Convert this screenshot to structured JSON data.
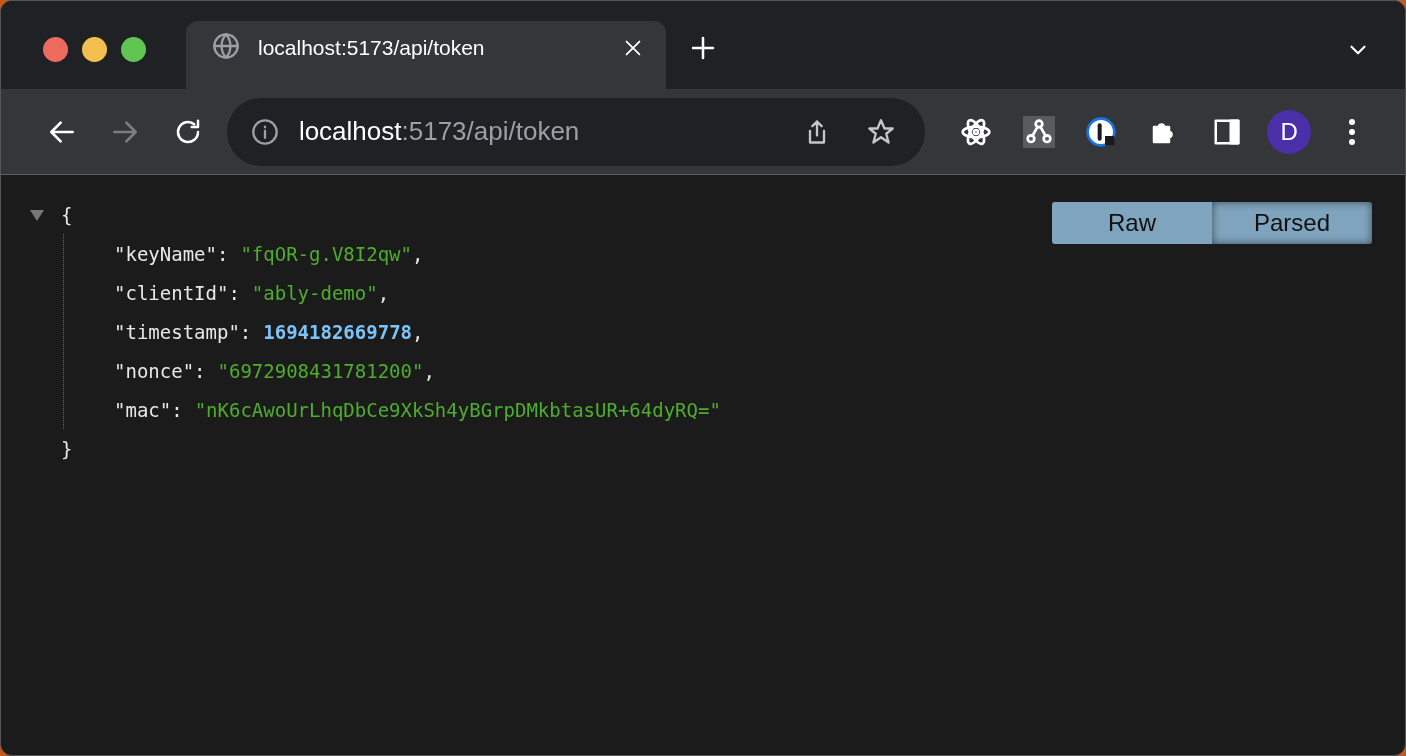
{
  "tab": {
    "title": "localhost:5173/api/token",
    "selected": true
  },
  "address": {
    "host": "localhost",
    "path": ":5173/api/token"
  },
  "profile": {
    "initial": "D"
  },
  "json_viewer": {
    "expanded": true,
    "open_brace": "{",
    "close_brace": "}",
    "entries": [
      {
        "key": "\"keyName\"",
        "colon": ":",
        "value": "\"fqOR-g.V8I2qw\"",
        "kind": "string",
        "comma": ","
      },
      {
        "key": "\"clientId\"",
        "colon": ":",
        "value": "\"ably-demo\"",
        "kind": "string",
        "comma": ","
      },
      {
        "key": "\"timestamp\"",
        "colon": ":",
        "value": "1694182669778",
        "kind": "number",
        "comma": ","
      },
      {
        "key": "\"nonce\"",
        "colon": ":",
        "value": "\"6972908431781200\"",
        "kind": "string",
        "comma": ","
      },
      {
        "key": "\"mac\"",
        "colon": ":",
        "value": "\"nK6cAwoUrLhqDbCe9XkSh4yBGrpDMkbtasUR+64dyRQ=\"",
        "kind": "string"
      }
    ]
  },
  "view_toggle": [
    {
      "label": "Raw",
      "selected": false
    },
    {
      "label": "Parsed",
      "selected": true
    }
  ]
}
